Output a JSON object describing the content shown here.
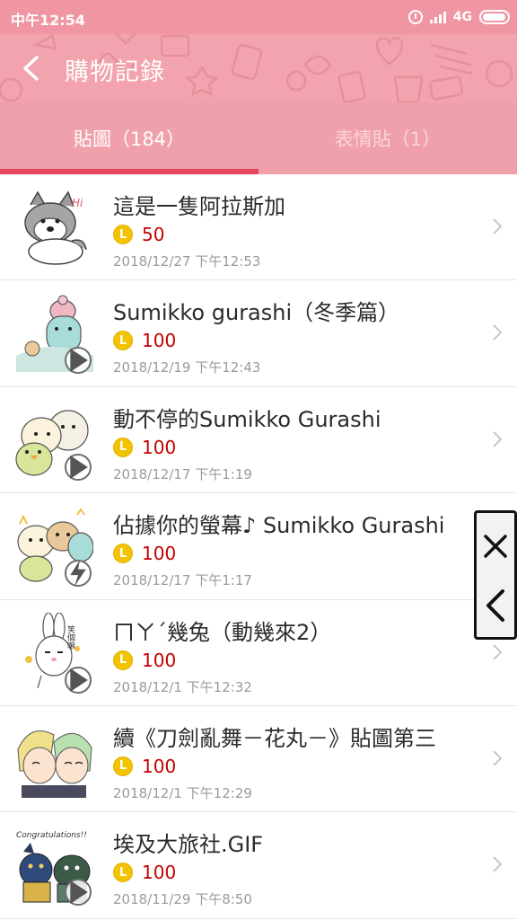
{
  "status_bar": {
    "time": "中午12:54",
    "network": "4G"
  },
  "header": {
    "title": "購物記錄"
  },
  "tabs": [
    {
      "label": "貼圖（184）",
      "active": true
    },
    {
      "label": "表情貼（1）",
      "active": false
    }
  ],
  "colors": {
    "header_pink": "#f3a3ad",
    "tab_indicator": "#e8445e",
    "price_red": "#c40000",
    "coin_yellow": "#f3c300"
  },
  "purchases": [
    {
      "title": "這是一隻阿拉斯加",
      "coin_symbol": "L",
      "price": "50",
      "date": "2018/12/27 下午12:53",
      "badge": "none"
    },
    {
      "title": "Sumikko gurashi（冬季篇）",
      "coin_symbol": "L",
      "price": "100",
      "date": "2018/12/19 下午12:43",
      "badge": "play-icon"
    },
    {
      "title": "動不停的Sumikko Gurashi",
      "coin_symbol": "L",
      "price": "100",
      "date": "2018/12/17 下午1:19",
      "badge": "play-icon"
    },
    {
      "title": "佔據你的螢幕♪ Sumikko Gurashi",
      "coin_symbol": "L",
      "price": "100",
      "date": "2018/12/17 下午1:17",
      "badge": "lightning-icon"
    },
    {
      "title": "ㄇㄚˊ幾兔（動幾來2）",
      "coin_symbol": "L",
      "price": "100",
      "date": "2018/12/1 下午12:32",
      "badge": "play-icon"
    },
    {
      "title": "續《刀劍亂舞－花丸－》貼圖第三",
      "coin_symbol": "L",
      "price": "100",
      "date": "2018/12/1 下午12:29",
      "badge": "none"
    },
    {
      "title": "埃及大旅社.GIF",
      "coin_symbol": "L",
      "price": "100",
      "date": "2018/11/29 下午8:50",
      "badge": "play-icon"
    }
  ],
  "thumbnails": {
    "text_hi": "Hi",
    "text_rabbit": "笑個嘛",
    "text_congrats": "Congratulations!!"
  },
  "overlay": {
    "close_icon": "close-icon",
    "back_icon": "chevron-left-icon"
  }
}
